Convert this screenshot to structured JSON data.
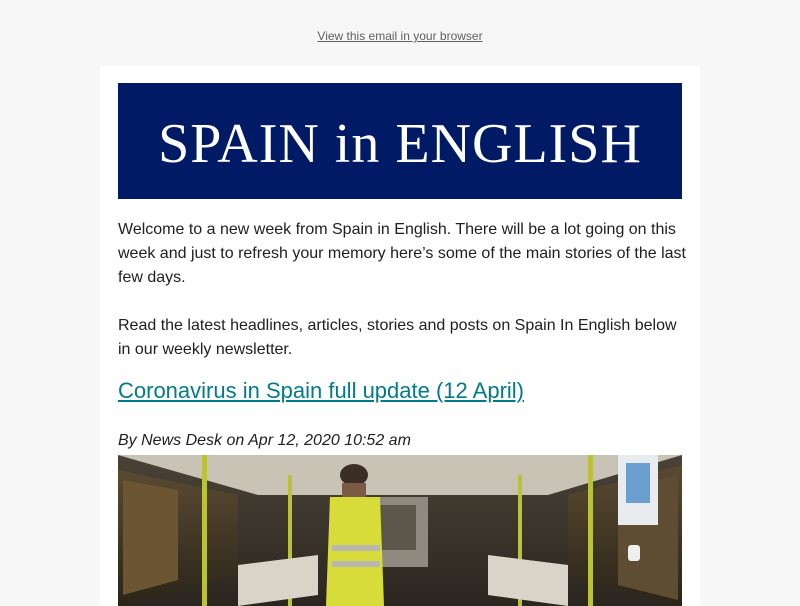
{
  "preheader": {
    "browser_link": "View this email in your browser"
  },
  "header": {
    "title": "SPAIN in ENGLISH"
  },
  "intro": {
    "paragraph_1": "Welcome to a new week from Spain in English. There will be a lot going on this week and just to refresh your memory here’s some of the main stories of the last few days.",
    "paragraph_2": "Read the latest headlines, articles, stories and posts on Spain In English below in our weekly newsletter."
  },
  "article": {
    "title": "Coronavirus in Spain full update (12 April)",
    "byline": "By News Desk on Apr 12, 2020 10:52 am",
    "image_icon": "photo-icon"
  },
  "colors": {
    "banner_bg": "#001a66",
    "link": "#007c89",
    "page_bg": "#f7f7f7"
  }
}
